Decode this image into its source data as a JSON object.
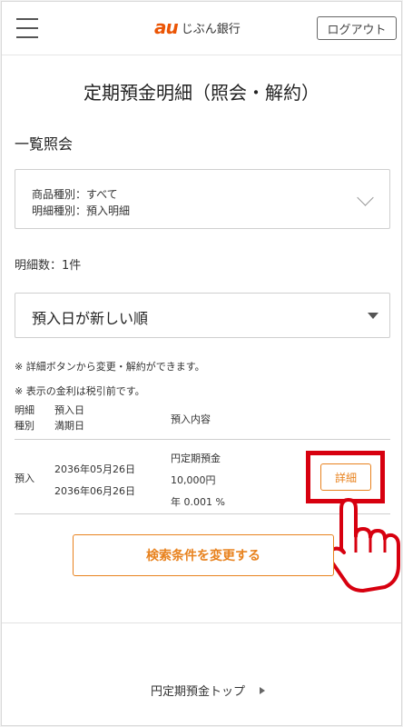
{
  "header": {
    "logo_brand": "au",
    "logo_text": "じぶん銀行",
    "logout_label": "ログアウト"
  },
  "page": {
    "title": "定期預金明細（照会・解約）",
    "section_title": "一覧照会"
  },
  "filter": {
    "line1": "商品種別：すべて",
    "line2": "明細種別：預入明細"
  },
  "count_label": "明細数：1件",
  "sort": {
    "selected": "預入日が新しい順"
  },
  "notes": [
    "※ 詳細ボタンから変更・解約ができます。",
    "※ 表示の金利は税引前です。"
  ],
  "table": {
    "headers": {
      "col1_line1": "明細",
      "col1_line2": "種別",
      "col2_line1": "預入日",
      "col2_line2": "満期日",
      "col3": "預入内容"
    },
    "rows": [
      {
        "type": "預入",
        "deposit_date": "2036年05月26日",
        "maturity_date": "2036年06月26日",
        "product": "円定期預金",
        "amount": "10,000円",
        "rate": "年 0.001 %",
        "detail_label": "詳細"
      }
    ]
  },
  "change_button_label": "検索条件を変更する",
  "bottom_link_label": "円定期預金トップ",
  "colors": {
    "accent": "#e8821e",
    "brand": "#eb5505",
    "highlight": "#d7000f"
  }
}
